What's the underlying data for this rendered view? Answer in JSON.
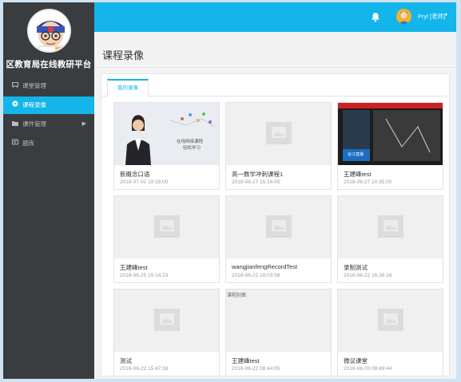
{
  "sidebar": {
    "platform_title": "区教育局在线教研平台",
    "items": [
      {
        "label": "课堂管理",
        "icon": "board-icon"
      },
      {
        "label": "课程录像",
        "icon": "video-icon"
      },
      {
        "label": "课件管理",
        "icon": "folder-icon",
        "caret": "▶"
      },
      {
        "label": "题库",
        "icon": "question-bank-icon"
      }
    ]
  },
  "topbar": {
    "user_name": "Pryl [老师]",
    "caret": "▾"
  },
  "page": {
    "title": "课程录像",
    "tab_label": "我的录像"
  },
  "cards": [
    {
      "title": "新概念口语",
      "date": "2018-07-02 19:28:00",
      "thumb": "teacher-photo",
      "thumb_text": [
        "在线网络课程",
        "轻松学习"
      ]
    },
    {
      "title": "高一数学冲刺课程1",
      "date": "2018-06-27 15:16:00",
      "thumb": "placeholder"
    },
    {
      "title": "王建峰test",
      "date": "2018-06-27 10:35:00",
      "thumb": "screen-capture",
      "thumb_text": [
        "谷江直播"
      ]
    },
    {
      "title": "王建峰test",
      "date": "2018-06-25 15:14:23",
      "thumb": "placeholder"
    },
    {
      "title": "wangjianfengRecordTest",
      "date": "2018-06-22 18:03:58",
      "thumb": "placeholder"
    },
    {
      "title": "录制测试",
      "date": "2018-06-22 16:38:16",
      "thumb": "placeholder"
    },
    {
      "title": "测试",
      "date": "2018-06-22 15:47:39",
      "thumb": "placeholder"
    },
    {
      "title": "王建峰test",
      "date": "2018-06-22 08:44:05",
      "thumb": "broken",
      "broken_alt": "课程封面"
    },
    {
      "title": "微议课堂",
      "date": "2018-06-20 08:49:44",
      "thumb": "placeholder"
    }
  ],
  "colors": {
    "accent": "#13b5ea",
    "sidebar_bg": "#3a3d40",
    "content_bg": "#f3f3f3"
  }
}
